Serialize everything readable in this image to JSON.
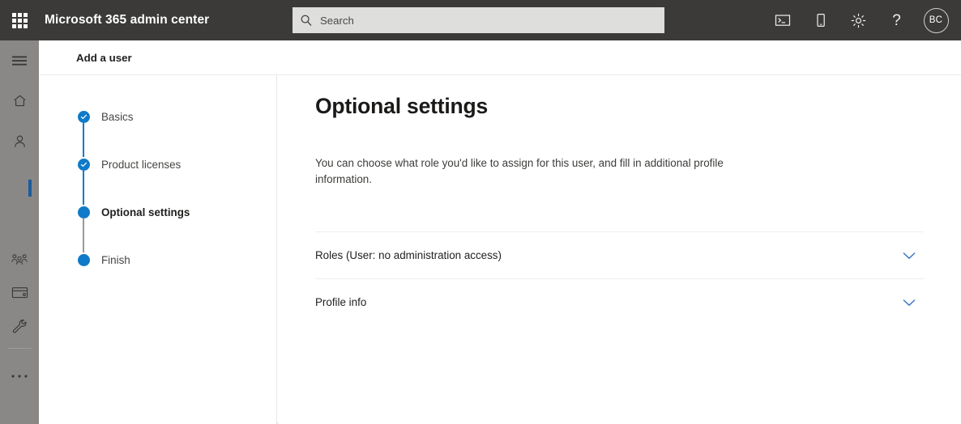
{
  "header": {
    "app_launcher_icon": "waffle-grid-icon",
    "brand": "Microsoft 365 admin center",
    "search": {
      "placeholder": "Search",
      "value": "",
      "icon": "search-icon"
    },
    "actions": [
      {
        "name": "console-icon",
        "glyph": "console"
      },
      {
        "name": "mobile-device-icon",
        "glyph": "mobile"
      },
      {
        "name": "gear-icon",
        "glyph": "gear"
      },
      {
        "name": "help-icon",
        "glyph": "?"
      }
    ],
    "avatar": {
      "initials": "BC"
    }
  },
  "sidebar": {
    "items": [
      {
        "name": "hamburger-menu-icon",
        "glyph": "hamburger",
        "active": false
      },
      {
        "name": "home-icon",
        "glyph": "home",
        "active": false
      },
      {
        "name": "users-icon",
        "glyph": "person",
        "active": true
      },
      {
        "name": "groups-icon",
        "glyph": "groups",
        "active": false
      },
      {
        "name": "billing-icon",
        "glyph": "card",
        "active": false
      },
      {
        "name": "setup-icon",
        "glyph": "wrench",
        "active": false
      },
      {
        "name": "show-all-icon",
        "glyph": "ellipsis",
        "active": false
      }
    ]
  },
  "page": {
    "title": "Add a user"
  },
  "wizard": {
    "steps": [
      {
        "label": "Basics",
        "state": "complete",
        "connector": "blue"
      },
      {
        "label": "Product licenses",
        "state": "complete",
        "connector": "blue"
      },
      {
        "label": "Optional settings",
        "state": "current",
        "connector": "gray"
      },
      {
        "label": "Finish",
        "state": "upcoming",
        "connector": "none"
      }
    ]
  },
  "main": {
    "heading": "Optional settings",
    "description": "You can choose what role you'd like to assign for this user, and fill in additional profile information.",
    "sections": [
      {
        "label": "Roles (User: no administration access)",
        "expanded": false,
        "icon": "chevron-down-icon"
      },
      {
        "label": "Profile info",
        "expanded": false,
        "icon": "chevron-down-icon"
      }
    ]
  },
  "colors": {
    "header_bg": "#3b3a39",
    "rail_bg": "#8a8886",
    "accent_blue": "#0f7ac8",
    "chevron_blue": "#3b78c3",
    "active_indicator": "#1b5c9e"
  }
}
